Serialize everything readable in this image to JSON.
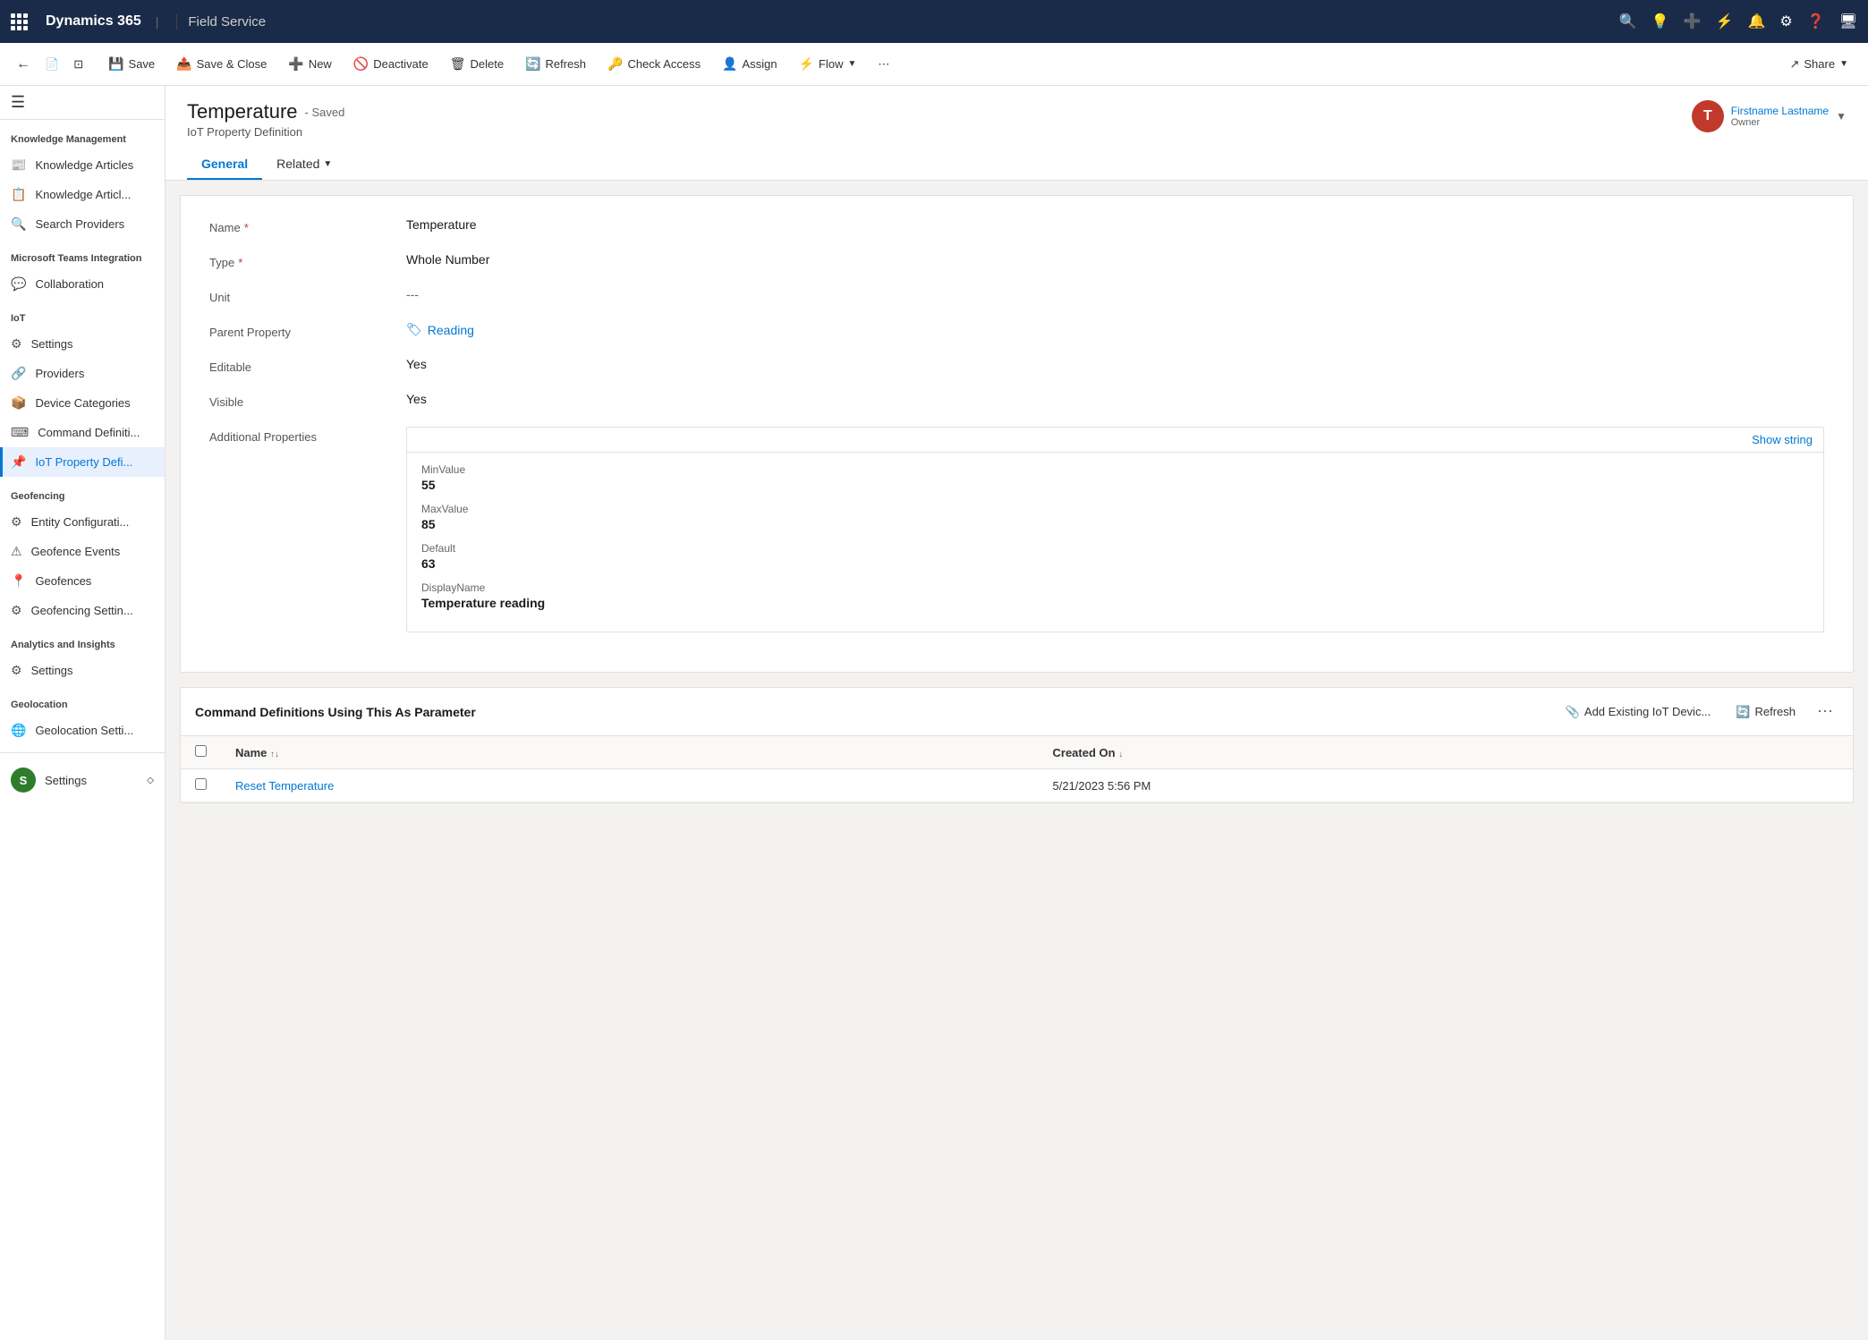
{
  "app": {
    "name": "Dynamics 365",
    "module": "Field Service"
  },
  "command_bar": {
    "back_label": "←",
    "record_label": "📄",
    "detach_label": "⊡",
    "save_label": "Save",
    "save_close_label": "Save & Close",
    "new_label": "New",
    "deactivate_label": "Deactivate",
    "delete_label": "Delete",
    "refresh_label": "Refresh",
    "check_access_label": "Check Access",
    "assign_label": "Assign",
    "flow_label": "Flow",
    "more_label": "⋯",
    "share_label": "Share"
  },
  "record": {
    "title": "Temperature",
    "saved_badge": "- Saved",
    "subtitle": "IoT Property Definition",
    "owner_initial": "T",
    "owner_name": "Firstname Lastname",
    "owner_label": "Owner"
  },
  "tabs": [
    {
      "label": "General",
      "active": true
    },
    {
      "label": "Related",
      "active": false,
      "has_dropdown": true
    }
  ],
  "form": {
    "name_label": "Name",
    "name_value": "Temperature",
    "type_label": "Type",
    "type_value": "Whole Number",
    "unit_label": "Unit",
    "unit_value": "---",
    "parent_property_label": "Parent Property",
    "parent_property_value": "Reading",
    "editable_label": "Editable",
    "editable_value": "Yes",
    "visible_label": "Visible",
    "visible_value": "Yes",
    "additional_properties_label": "Additional Properties",
    "show_string_label": "Show string",
    "min_value_key": "MinValue",
    "min_value_val": "55",
    "max_value_key": "MaxValue",
    "max_value_val": "85",
    "default_key": "Default",
    "default_val": "63",
    "display_name_key": "DisplayName",
    "display_name_val": "Temperature reading"
  },
  "subgrid": {
    "title": "Command Definitions Using This As Parameter",
    "add_existing_label": "Add Existing IoT Devic...",
    "refresh_label": "Refresh",
    "col_name": "Name",
    "col_created_on": "Created On",
    "rows": [
      {
        "name": "Reset Temperature",
        "created_on": "5/21/2023 5:56 PM"
      }
    ]
  },
  "sidebar": {
    "sections": [
      {
        "title": "Knowledge Management",
        "items": [
          {
            "label": "Knowledge Articles",
            "icon": "📰",
            "active": false
          },
          {
            "label": "Knowledge Articl...",
            "icon": "📋",
            "active": false
          },
          {
            "label": "Search Providers",
            "icon": "🔍",
            "active": false
          }
        ]
      },
      {
        "title": "Microsoft Teams Integration",
        "items": [
          {
            "label": "Collaboration",
            "icon": "💬",
            "active": false
          }
        ]
      },
      {
        "title": "IoT",
        "items": [
          {
            "label": "Settings",
            "icon": "⚙",
            "active": false
          },
          {
            "label": "Providers",
            "icon": "🔗",
            "active": false
          },
          {
            "label": "Device Categories",
            "icon": "📦",
            "active": false
          },
          {
            "label": "Command Definiti...",
            "icon": "⌨",
            "active": false
          },
          {
            "label": "IoT Property Defi...",
            "icon": "📌",
            "active": true
          }
        ]
      },
      {
        "title": "Geofencing",
        "items": [
          {
            "label": "Entity Configurati...",
            "icon": "⚙",
            "active": false
          },
          {
            "label": "Geofence Events",
            "icon": "⚠",
            "active": false
          },
          {
            "label": "Geofences",
            "icon": "📍",
            "active": false
          },
          {
            "label": "Geofencing Settin...",
            "icon": "⚙",
            "active": false
          }
        ]
      },
      {
        "title": "Analytics and Insights",
        "items": [
          {
            "label": "Settings",
            "icon": "⚙",
            "active": false
          }
        ]
      },
      {
        "title": "Geolocation",
        "items": [
          {
            "label": "Geolocation Setti...",
            "icon": "🌐",
            "active": false
          }
        ]
      }
    ]
  }
}
